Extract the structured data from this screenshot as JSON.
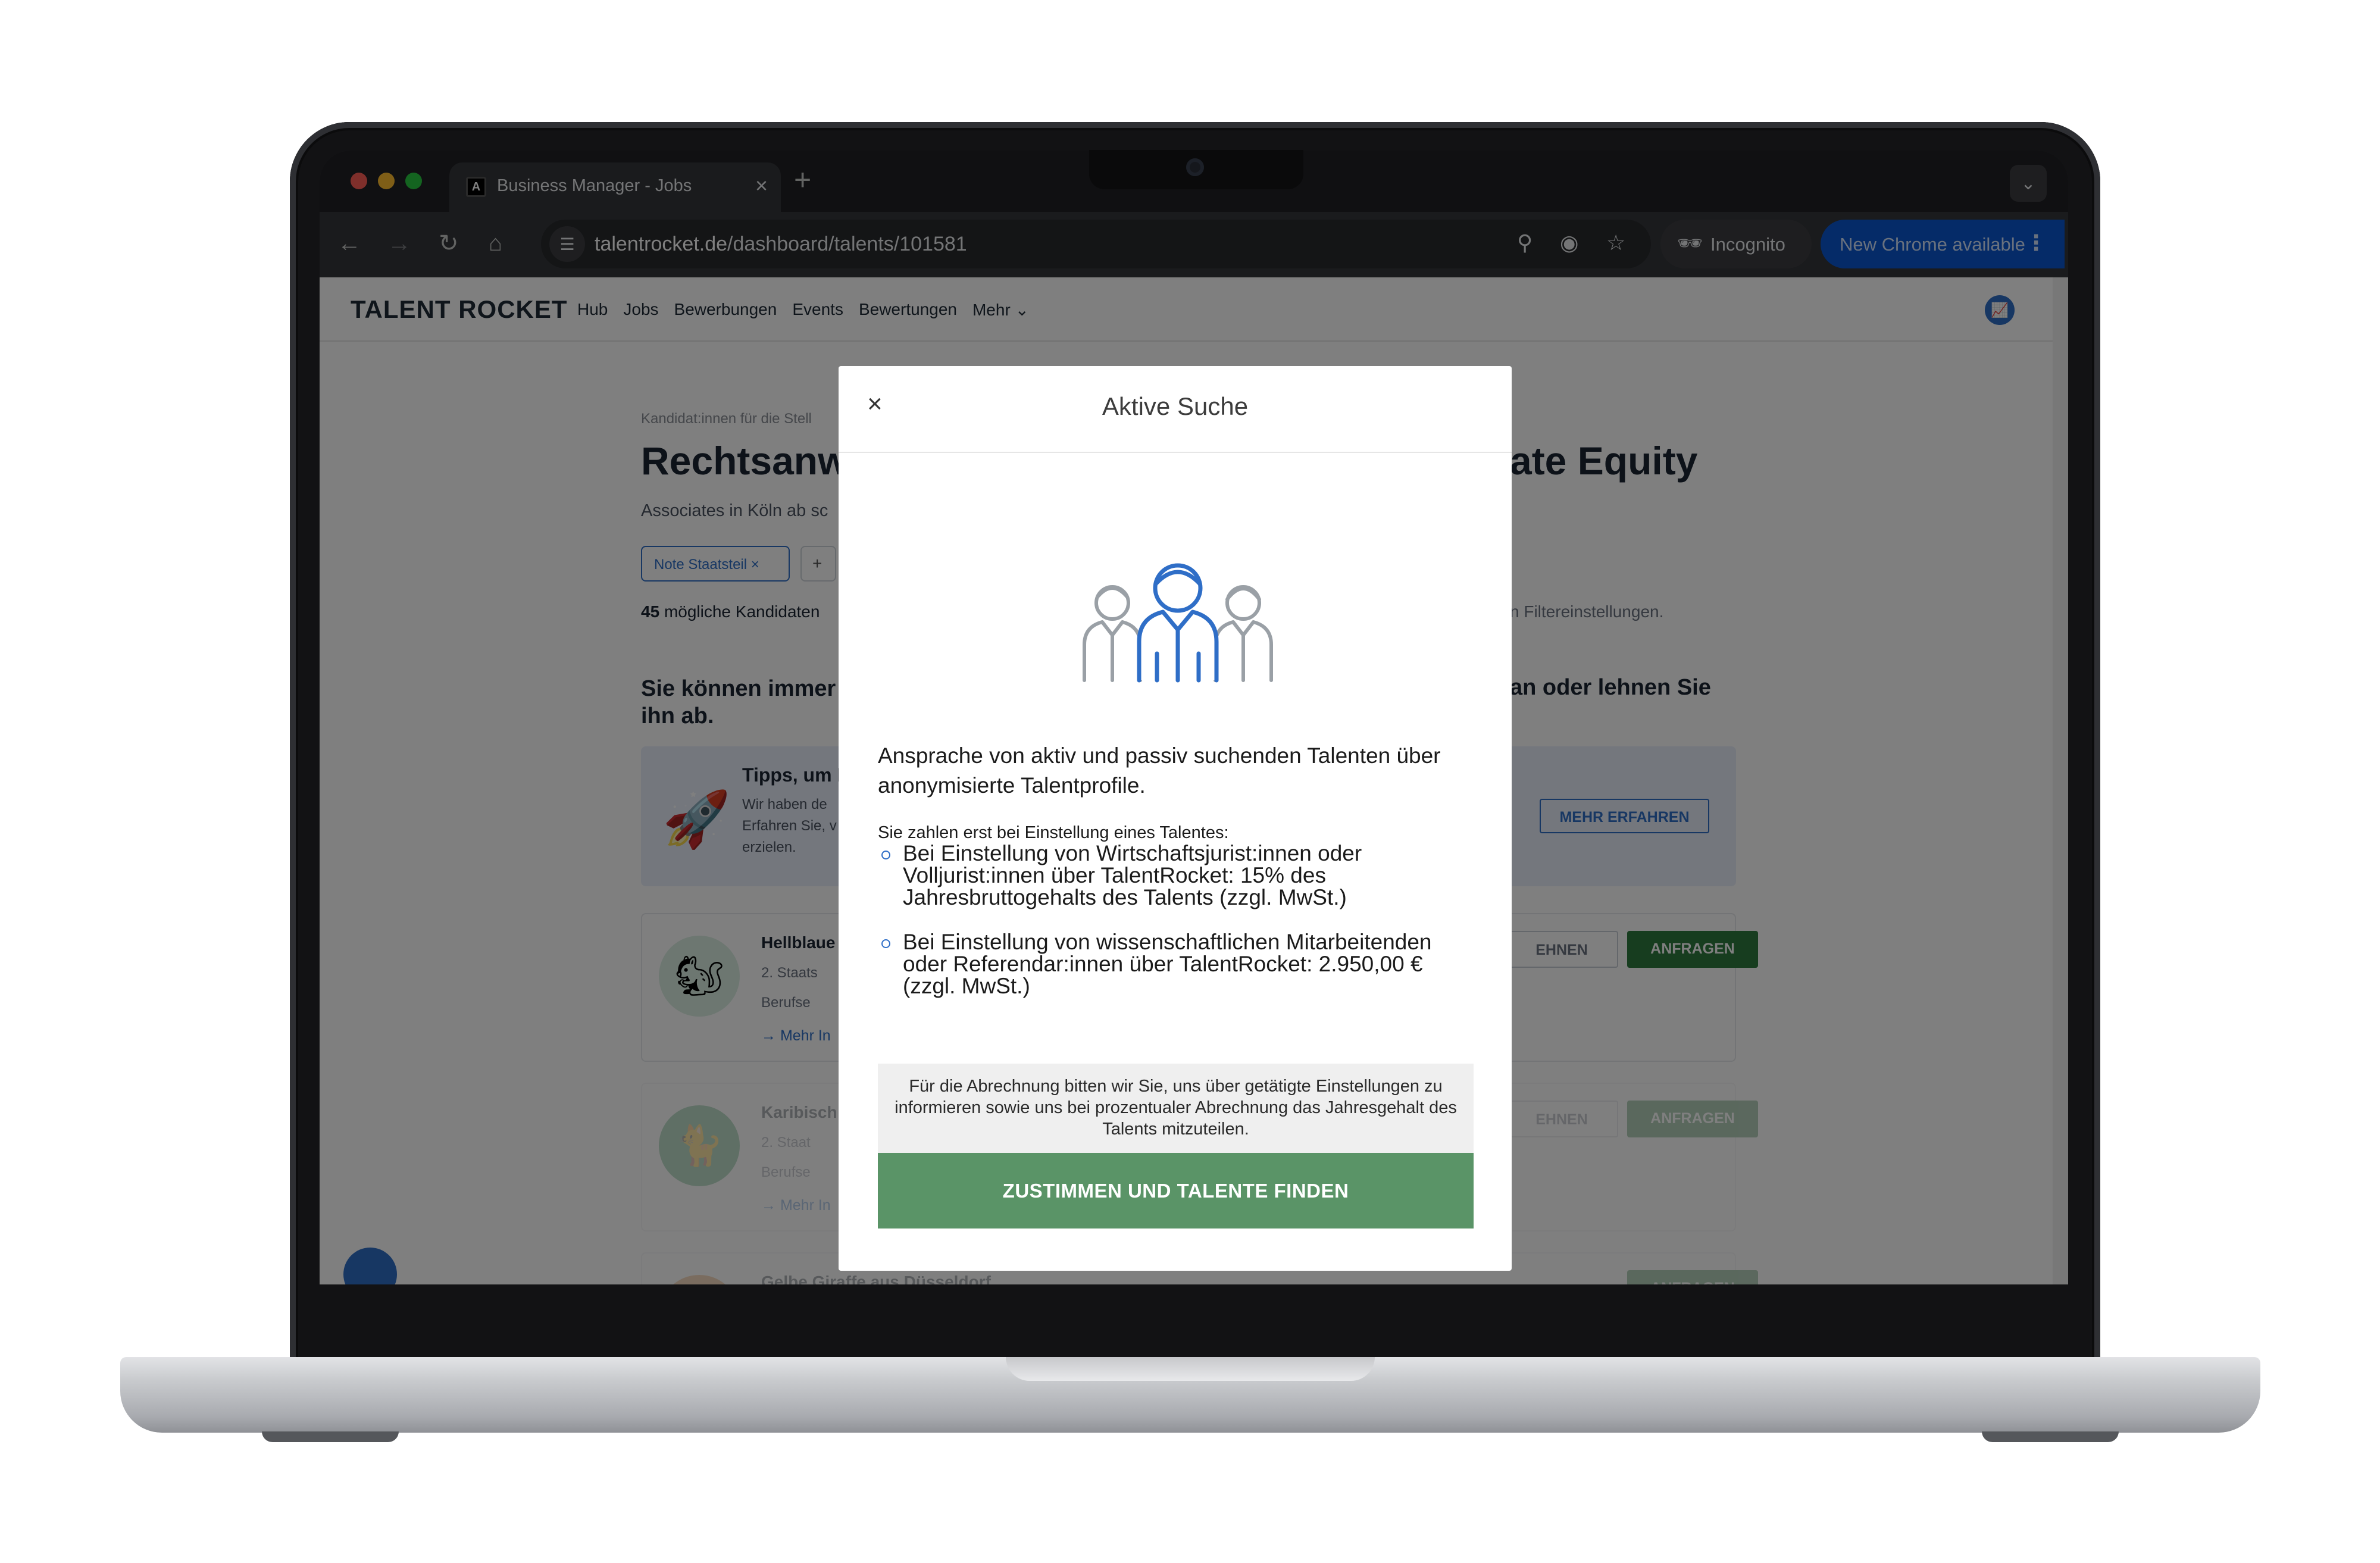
{
  "browser": {
    "tab_title": "Business Manager - Jobs",
    "tab_favicon": "A",
    "url_host": "talentrocket.de",
    "url_path": "/dashboard/talents/101581",
    "incognito_label": "Incognito",
    "update_label": "New Chrome available"
  },
  "site": {
    "logo": "TALENT ROCKET",
    "nav": [
      "Hub",
      "Jobs",
      "Bewerbungen",
      "Events",
      "Bewertungen",
      "Mehr"
    ]
  },
  "page": {
    "crumb": "Kandidat:innen für die Stell",
    "title_start": "Rechtsanw",
    "title_end": "ate Equity",
    "subtitle": "Associates in Köln ab sc",
    "filter_chip": "Note Staatsteil",
    "count_bold": "45",
    "count_text": "mögliche Kandidaten",
    "count_right": "n Filtereinstellungen.",
    "info_start": "Sie können immer",
    "info_end": "ihn ab.",
    "info_right": "an oder lehnen Sie",
    "tips": {
      "title": "Tipps, um I",
      "text": "Wir haben de Erfahren Sie, v zu erzielen.",
      "button": "MEHR ERFAHREN"
    },
    "candidates": [
      {
        "name": "Hellblaue",
        "line1": "2. Staats",
        "line2": "Berufse",
        "link": "Mehr In",
        "decline": "EHNEN",
        "request": "ANFRAGEN",
        "avatar_color": "#dbeee3"
      },
      {
        "name": "Karibisch",
        "line1": "2. Staat",
        "line2": "Berufse",
        "link": "Mehr In",
        "decline": "EHNEN",
        "request": "ANFRAGEN",
        "avatar_color": "#4aa36a"
      },
      {
        "name": "Gelbe Giraffe aus Düsseldorf",
        "line1": "",
        "line2": "",
        "link": "",
        "decline": "",
        "request": "ANFRAGEN",
        "avatar_color": "#e0954b"
      }
    ]
  },
  "modal": {
    "title": "Aktive Suche",
    "lead": "Ansprache von aktiv und passiv suchenden Talenten über anonymisierte Talentprofile.",
    "intro": "Sie zahlen erst bei Einstellung eines Talentes:",
    "items": [
      "Bei Einstellung von Wirtschaftsjurist:innen oder Volljurist:innen über TalentRocket: 15% des Jahresbruttogehalts des Talents (zzgl. MwSt.)",
      "Bei Einstellung von wissenschaftlichen Mitarbeitenden oder Referendar:innen über TalentRocket: 2.950,00 € (zzgl. MwSt.)"
    ],
    "billing_note": "Für die Abrechnung bitten wir Sie, uns über getätigte Einstellungen zu informieren sowie uns bei prozentualer Abrechnung das Jahresgehalt des Talents mitzuteilen.",
    "agree_button": "ZUSTIMMEN UND TALENTE FINDEN"
  },
  "colors": {
    "accent_blue": "#2f6ec7",
    "agree_green": "#5a9467",
    "request_green": "#2f7a3f",
    "chrome_update": "#0b57d0"
  }
}
